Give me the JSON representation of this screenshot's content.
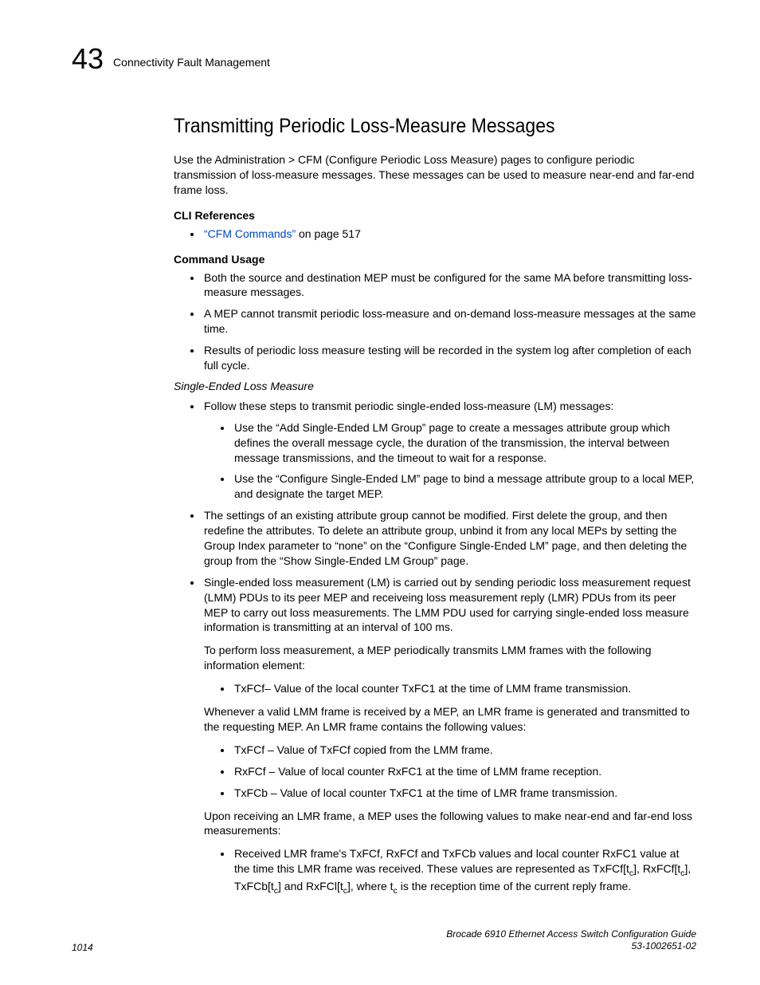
{
  "header": {
    "chapter": "43",
    "title": "Connectivity Fault Management"
  },
  "h2": "Transmitting Periodic Loss-Measure Messages",
  "intro": "Use the Administration > CFM (Configure Periodic Loss Measure) pages to configure periodic transmission of loss-measure messages. These messages can be used to measure near-end and far-end frame loss.",
  "cli_ref_heading": "CLI References",
  "cli_ref_link": "“CFM Commands”",
  "cli_ref_suffix": " on page 517",
  "cmd_usage_heading": "Command Usage",
  "cmd_usage": [
    "Both the source and destination MEP must be configured for the same MA before transmitting loss-measure messages.",
    "A MEP cannot transmit periodic loss-measure and on-demand loss-measure messages at the same time.",
    "Results of periodic loss measure testing will be recorded in the system log after completion of each full cycle."
  ],
  "section_italic": "Single-Ended Loss Measure",
  "se_intro": "Follow these steps to transmit periodic single-ended loss-measure (LM) messages:",
  "se_steps": [
    "Use the “Add Single-Ended LM Group” page to create a messages attribute group which defines the overall message cycle, the duration of the transmission, the interval between message transmissions, and the timeout to wait for a response.",
    "Use the “Configure Single-Ended LM” page to bind a message attribute group to a local MEP, and designate the target MEP."
  ],
  "se_bullets2": "The settings of an existing attribute group cannot be modified. First delete the group, and then redefine the attributes. To delete an attribute group, unbind it from any local MEPs by setting the Group Index parameter to “none” on the “Configure Single-Ended LM” page, and then deleting the group from the “Show Single-Ended LM Group” page.",
  "se_bullets3": "Single-ended loss measurement (LM) is carried out by sending periodic loss measurement request (LMM) PDUs to its peer MEP and receiveing loss measurement reply (LMR) PDUs from its peer MEP to carry out loss measurements. The LMM PDU used for carrying single-ended loss measure information is transmitting at an interval of 100 ms.",
  "se_para1": "To perform loss measurement, a MEP periodically transmits LMM frames with the following information element:",
  "se_txfcf": "TxFCf– Value of the local counter TxFC1 at the time of LMM frame transmission.",
  "se_para2": "Whenever a valid LMM frame is received by a MEP, an LMR frame is generated and transmitted to the requesting MEP. An LMR frame contains the following values:",
  "se_values": [
    "TxFCf – Value of TxFCf copied from the LMM frame.",
    "RxFCf – Value of local counter RxFC1 at the time of LMM frame reception.",
    "TxFCb – Value of local counter TxFC1 at the time of LMR frame transmission."
  ],
  "se_para3": "Upon receiving an LMR frame, a MEP uses the following values to make near-end and far-end loss measurements:",
  "se_received_a": "Received LMR frame's TxFCf, RxFCf and TxFCb values and local counter RxFC1 value at the time this LMR frame was received. These values are represented as TxFCf[t",
  "se_received_b": "], RxFCf[t",
  "se_received_c": "], TxFCb[t",
  "se_received_d": "] and RxFCl[t",
  "se_received_e": "], where t",
  "se_received_f": " is the reception time of the current reply frame.",
  "sub_c": "c",
  "footer": {
    "page": "1014",
    "doc1": "Brocade 6910 Ethernet Access Switch Configuration Guide",
    "doc2": "53-1002651-02"
  }
}
